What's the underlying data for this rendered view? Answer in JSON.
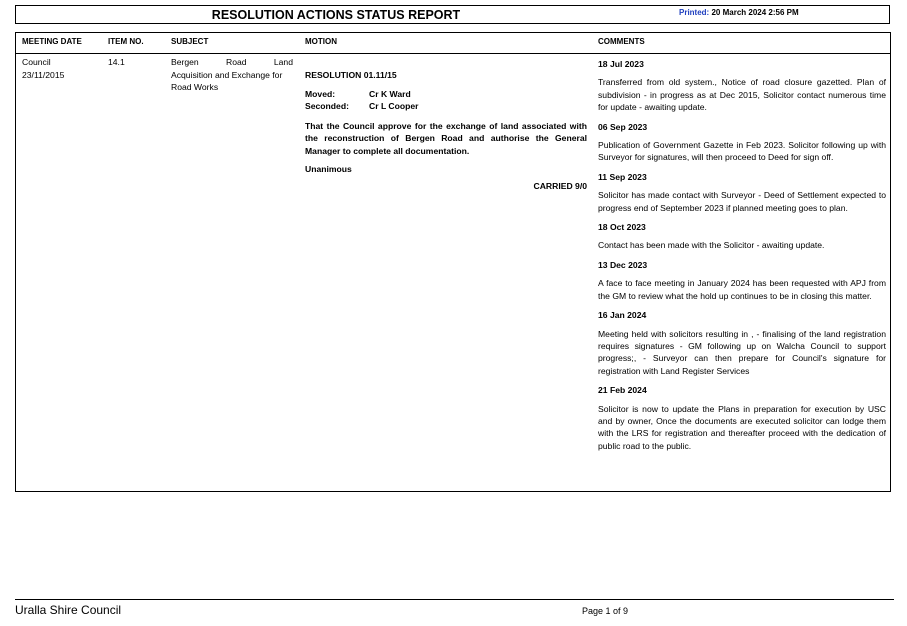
{
  "header": {
    "title": "RESOLUTION ACTIONS STATUS REPORT",
    "printed_label": "Printed:",
    "printed_value": "20 March 2024 2:56 PM"
  },
  "columns": {
    "meeting_date": "MEETING DATE",
    "item_no": "ITEM NO.",
    "subject": "SUBJECT",
    "motion": "MOTION",
    "comments": "COMMENTS"
  },
  "row": {
    "meeting": "Council",
    "date": "23/11/2015",
    "item_no": "14.1",
    "subject_line1_words": [
      "Bergen",
      "Road",
      "Land"
    ],
    "subject_line2": "Acquisition and Exchange for",
    "subject_line3": "Road Works",
    "resolution": "RESOLUTION 01.11/15",
    "moved_label": "Moved:",
    "moved_value": "Cr K Ward",
    "seconded_label": "Seconded:",
    "seconded_value": "Cr L Cooper",
    "motion_line1": "That the Council approve for the exchange of land associated with",
    "motion_line2": "the reconstruction of Bergen Road and authorise the General",
    "motion_line3": "Manager to complete all documentation.",
    "vote": "Unanimous",
    "carried": "CARRIED 9/0"
  },
  "comments": [
    {
      "date": "18 Jul 2023",
      "text": "Transferred from old system., Notice of road closure gazetted.  Plan of subdivision - in progress as at Dec 2015, Solicitor contact numerous time for update - awaiting update."
    },
    {
      "date": "06 Sep 2023",
      "text": "Publication of Government Gazette in Feb 2023. Solicitor following up with Surveyor for signatures, will then proceed to Deed for sign off."
    },
    {
      "date": "11 Sep 2023",
      "text": "Solicitor has made contact with Surveyor  - Deed of Settlement expected to progress end of September 2023 if planned meeting goes to plan."
    },
    {
      "date": "18 Oct 2023",
      "text": "Contact has been made with the Solicitor - awaiting update."
    },
    {
      "date": "13 Dec 2023",
      "text": "A face to face meeting in January 2024  has been requested with APJ from the GM to review what the hold up continues to be in closing this matter."
    },
    {
      "date": "16 Jan 2024",
      "text": "Meeting held with solicitors resulting in , - finalising of the land registration requires signatures - GM following up on Walcha Council to support progress;, - Surveyor can then prepare for Council's signature for registration with Land Register Services"
    },
    {
      "date": "21 Feb 2024",
      "text": "Solicitor is now to update the Plans in preparation for execution by USC and by owner, Once the documents are executed solicitor can lodge them with the LRS for registration and thereafter proceed with the dedication of public road to the public."
    }
  ],
  "footer": {
    "organisation": "Uralla Shire Council",
    "page": "Page 1 of 9"
  }
}
